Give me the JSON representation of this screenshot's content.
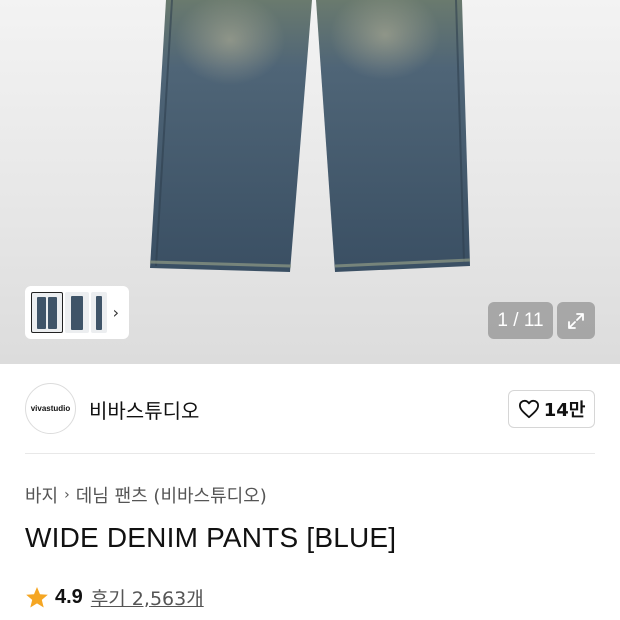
{
  "gallery": {
    "image_alt": "WIDE DENIM PANTS [BLUE]",
    "pager": "1 / 11",
    "thumbnails": [
      "thumbnail-1",
      "thumbnail-2",
      "thumbnail-3"
    ],
    "thumbnail_more_icon": "chevron-right-icon",
    "expand_icon": "expand-icon"
  },
  "brand": {
    "logo_text": "vivastudio",
    "name": "비바스튜디오",
    "like_icon": "heart-outline-icon",
    "like_count": "14만"
  },
  "breadcrumb": {
    "items": [
      "바지",
      "데님 팬츠 (비바스튜디오)"
    ],
    "separator_icon": "chevron-right-icon"
  },
  "product": {
    "title": "WIDE DENIM PANTS [BLUE]"
  },
  "rating": {
    "star_icon": "star-icon",
    "star_color": "#F5A623",
    "value": "4.9",
    "reviews_label": "후기 2,563개"
  }
}
